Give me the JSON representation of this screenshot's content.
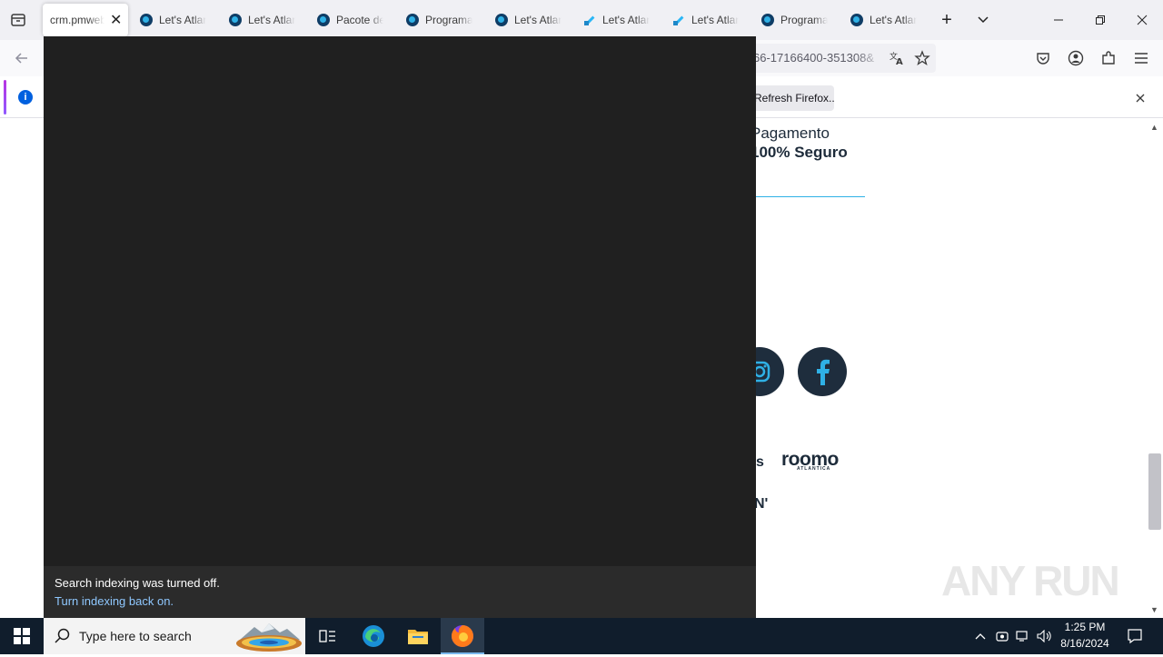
{
  "browser": {
    "tabs": [
      {
        "label": "crm.pmweb",
        "active": true
      },
      {
        "label": "Let's Atlantica"
      },
      {
        "label": "Let's Atlantica"
      },
      {
        "label": "Pacote de"
      },
      {
        "label": "Programa"
      },
      {
        "label": "Let's Atlantica"
      },
      {
        "label": "Let's Atlantica"
      },
      {
        "label": "Let's Atlantica"
      },
      {
        "label": "Programa"
      },
      {
        "label": "Let's Atlantica"
      }
    ],
    "url_visible": "66-17166400-351308&",
    "notification": {
      "button_label": "Refresh Firefox..."
    }
  },
  "page": {
    "payment_line1": "Pagamento",
    "payment_line2": "100% Seguro",
    "partner_logo": "roomo",
    "partner_logo_sub": "ATLANTICA",
    "partial_text_1": "s",
    "partial_text_2": "N'",
    "social_icons": [
      "instagram-icon",
      "facebook-icon"
    ]
  },
  "search_panel": {
    "status_title": "Search indexing was turned off.",
    "status_link": "Turn indexing back on."
  },
  "taskbar": {
    "search_placeholder": "Type here to search",
    "time": "1:25 PM",
    "date": "8/16/2024"
  },
  "watermark": "ANY RUN",
  "colors": {
    "overlay": "#202020",
    "overlay_footer": "#2b2b2b",
    "link": "#8fc8ff",
    "taskbar": "#101d2c",
    "brand_dark": "#1e2d3d",
    "brand_accent": "#2fb1e6"
  }
}
